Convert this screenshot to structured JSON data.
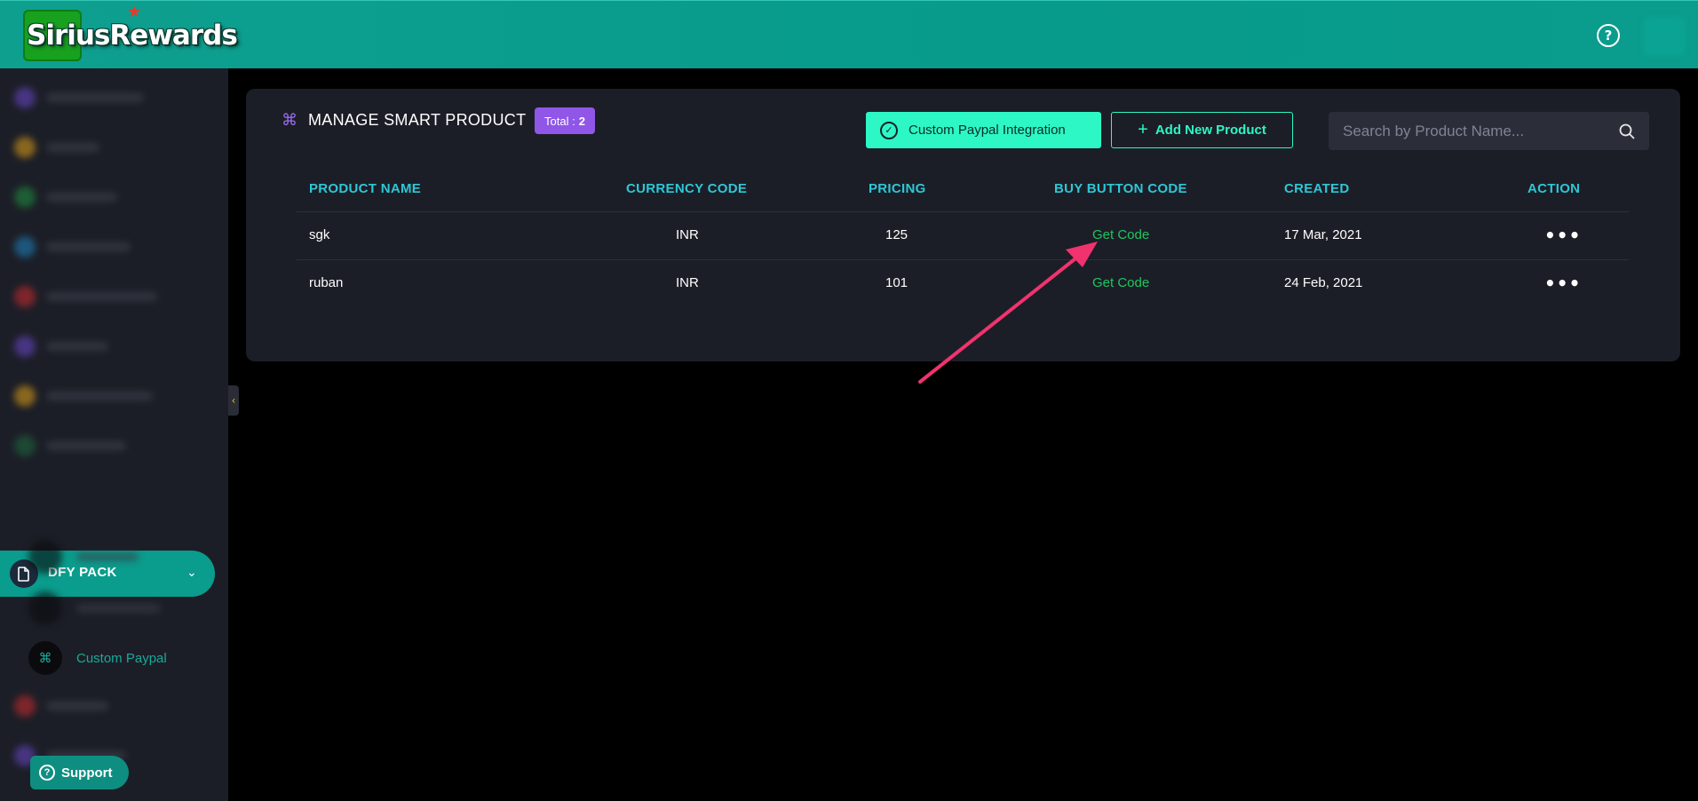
{
  "header": {
    "logo_text": "SiriusRewards",
    "help_icon": "help-circle-icon"
  },
  "sidebar": {
    "active_group": {
      "label": "DFY PACK",
      "icon": "document-icon"
    },
    "active_subitem": {
      "label": "Custom Paypal",
      "icon": "command-icon"
    },
    "support_label": "Support",
    "colors": {
      "accent": "#0a9c8c"
    }
  },
  "card": {
    "title": "MANAGE SMART PRODUCT",
    "total_label": "Total :",
    "total_value": "2",
    "paypal_button": "Custom Paypal Integration",
    "add_button": "Add New Product",
    "search_placeholder": "Search by Product Name..."
  },
  "table": {
    "headers": [
      "PRODUCT NAME",
      "CURRENCY CODE",
      "PRICING",
      "BUY BUTTON CODE",
      "CREATED",
      "ACTION"
    ],
    "rows": [
      {
        "name": "sgk",
        "currency": "INR",
        "pricing": "125",
        "code": "Get Code",
        "created": "17 Mar, 2021"
      },
      {
        "name": "ruban",
        "currency": "INR",
        "pricing": "101",
        "code": "Get Code",
        "created": "24 Feb, 2021"
      }
    ]
  },
  "colors": {
    "teal_header": "#079b8c",
    "mint_button": "#2df7c4",
    "purple_badge": "#9056e8",
    "header_text": "#2ec7d6",
    "get_code_green": "#1ec660",
    "annotation_arrow": "#f0336e"
  }
}
